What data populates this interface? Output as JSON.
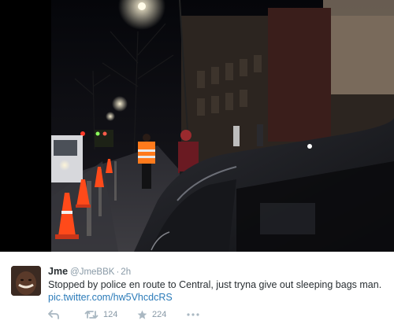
{
  "tweet": {
    "name": "Jme",
    "handle": "@JmeBBK",
    "separator": "·",
    "time": "2h",
    "text": "Stopped by police en route to Central, just tryna give out sleeping bags man.",
    "link": "pic.twitter.com/hw5VhcdcRS",
    "retweet_count": "124",
    "favorite_count": "224"
  },
  "icons": {
    "reply": "reply-icon",
    "retweet": "retweet-icon",
    "favorite": "star-icon",
    "more": "more-dots-icon"
  },
  "colors": {
    "name": "#292f33",
    "meta": "#8899a6",
    "link": "#2b7bb9"
  }
}
